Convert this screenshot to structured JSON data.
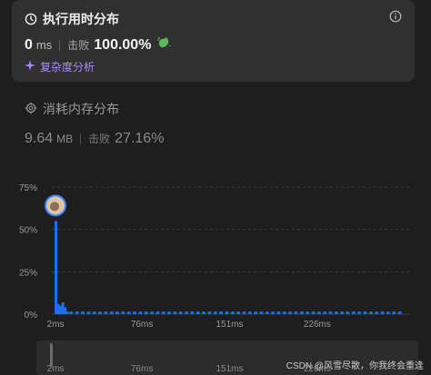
{
  "runtime": {
    "title": "执行用时分布",
    "value": "0",
    "unit": "ms",
    "beat_label": "击败",
    "beat_value": "100.00%",
    "complexity_link": "复杂度分析",
    "colors": {
      "card_bg": "#303030",
      "link": "#a78bfa"
    }
  },
  "memory": {
    "title": "消耗内存分布",
    "value": "9.64",
    "unit": "MB",
    "beat_label": "击败",
    "beat_value": "27.16%"
  },
  "chart_data": {
    "type": "bar",
    "y_tick_labels": [
      "75%",
      "50%",
      "25%",
      "0%"
    ],
    "y_ticks": [
      75,
      50,
      25,
      0
    ],
    "ylim": [
      0,
      75
    ],
    "x_tick_labels": [
      "2ms",
      "76ms",
      "151ms",
      "226ms"
    ],
    "xlim": [
      2,
      300
    ],
    "bar_color": "#1f6feb",
    "bars": [
      {
        "x": 2,
        "value": 55
      },
      {
        "x": 4,
        "value": 6
      },
      {
        "x": 6,
        "value": 5
      },
      {
        "x": 8,
        "value": 7
      },
      {
        "x": 10,
        "value": 4
      },
      {
        "x": 12,
        "value": 1.5
      }
    ],
    "baseline_bar_value": 1.5,
    "baseline_bar_count": 58,
    "grid": true,
    "selected_marker": "avatar"
  },
  "scrollbar": {
    "x_tick_labels": [
      "2ms",
      "76ms",
      "151ms",
      "226ms"
    ]
  },
  "watermark": "CSDN @风雪尽散，你我终会重逢"
}
